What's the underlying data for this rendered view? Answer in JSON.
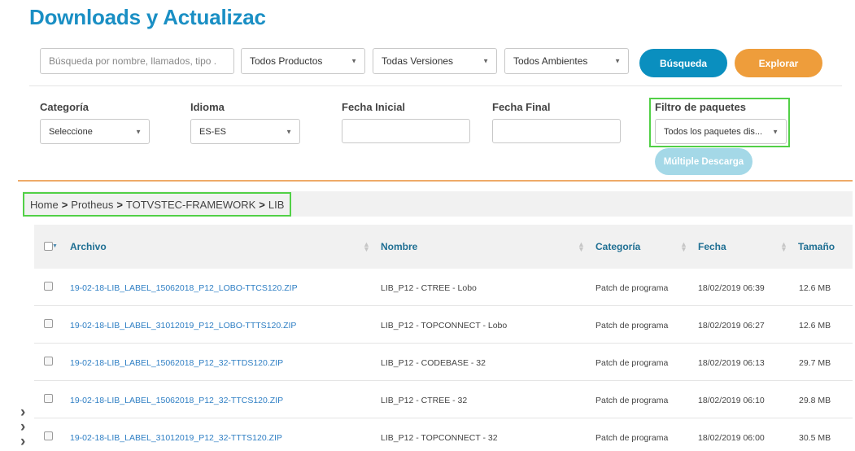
{
  "page": {
    "title": "Downloads y Actualizac"
  },
  "search": {
    "placeholder": "Búsqueda por nombre, llamados, tipo .",
    "products": "Todos Productos",
    "versions": "Todas Versiones",
    "environments": "Todos Ambientes",
    "search_label": "Búsqueda",
    "explore_label": "Explorar"
  },
  "filters": {
    "category_label": "Categoría",
    "category_value": "Seleccione",
    "language_label": "Idioma",
    "language_value": "ES-ES",
    "start_date_label": "Fecha Inicial",
    "end_date_label": "Fecha Final",
    "package_filter_label": "Filtro de paquetes",
    "package_filter_value": "Todos los paquetes dis...",
    "multi_download_label": "Múltiple Descarga"
  },
  "breadcrumb": [
    "Home",
    "Protheus",
    "TOTVSTEC-FRAMEWORK",
    "LIB"
  ],
  "table": {
    "headers": [
      "Archivo",
      "Nombre",
      "Categoría",
      "Fecha",
      "Tamaño"
    ],
    "rows": [
      {
        "file": "19-02-18-LIB_LABEL_15062018_P12_LOBO-TTCS120.ZIP",
        "name": "LIB_P12 - CTREE - Lobo",
        "category": "Patch de programa",
        "date": "18/02/2019 06:39",
        "size": "12.6 MB"
      },
      {
        "file": "19-02-18-LIB_LABEL_31012019_P12_LOBO-TTTS120.ZIP",
        "name": "LIB_P12 - TOPCONNECT - Lobo",
        "category": "Patch de programa",
        "date": "18/02/2019 06:27",
        "size": "12.6 MB"
      },
      {
        "file": "19-02-18-LIB_LABEL_15062018_P12_32-TTDS120.ZIP",
        "name": "LIB_P12 - CODEBASE - 32",
        "category": "Patch de programa",
        "date": "18/02/2019 06:13",
        "size": "29.7 MB"
      },
      {
        "file": "19-02-18-LIB_LABEL_15062018_P12_32-TTCS120.ZIP",
        "name": "LIB_P12 - CTREE - 32",
        "category": "Patch de programa",
        "date": "18/02/2019 06:10",
        "size": "29.8 MB"
      },
      {
        "file": "19-02-18-LIB_LABEL_31012019_P12_32-TTTS120.ZIP",
        "name": "LIB_P12 - TOPCONNECT - 32",
        "category": "Patch de programa",
        "date": "18/02/2019 06:00",
        "size": "30.5 MB"
      }
    ]
  },
  "colors": {
    "title": "#1a8fc4",
    "search_button": "#0a8fbf",
    "explore_button": "#ee9d3b",
    "multi_download_button": "#a4d8e7",
    "highlight": "#52d047",
    "divider": "#eeaa68",
    "link": "#2f7fc4"
  },
  "icons": {
    "select_caret": "caret-down-icon",
    "breadcrumb_separator": "chevron-right-icon",
    "sort": "sort-icon",
    "side_nav": "chevron-right-icon"
  }
}
